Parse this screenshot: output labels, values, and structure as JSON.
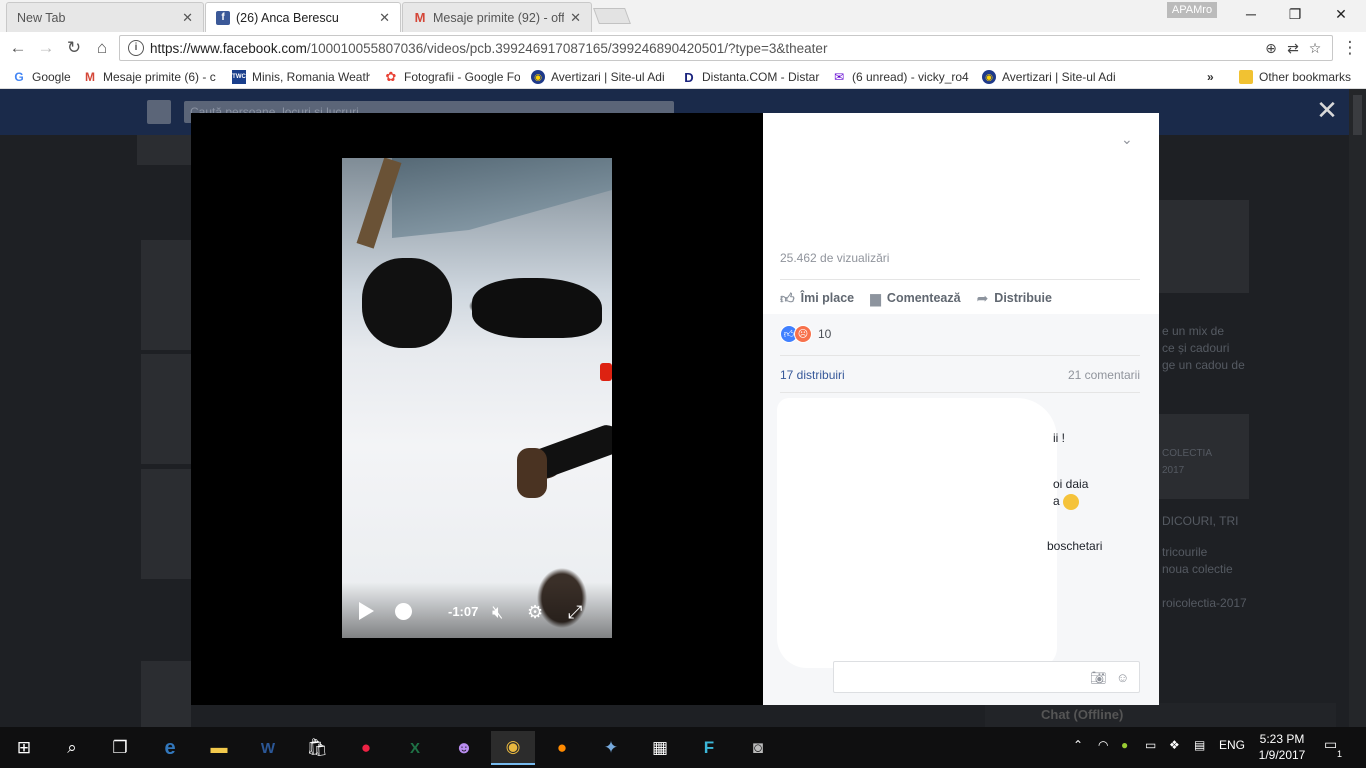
{
  "browser": {
    "tabs": [
      {
        "title": "New Tab",
        "active": false
      },
      {
        "title": "(26) Anca Berescu",
        "active": true
      },
      {
        "title": "Mesaje primite (92) - off",
        "active": false
      }
    ],
    "profile": "APAMro",
    "url_prefix": "https://www.facebook.com",
    "url_path": "/100010055807036/videos/pcb.399246917087165/399246890420501/?type=3&theater",
    "bookmarks": [
      {
        "label": "Google",
        "icon": "google-icon"
      },
      {
        "label": "Mesaje primite (6) - c",
        "icon": "gmail-icon"
      },
      {
        "label": "Minis, Romania Weath",
        "icon": "weather-channel-icon"
      },
      {
        "label": "Fotografii - Google Fo",
        "icon": "google-photos-icon"
      },
      {
        "label": "Avertizari | Site-ul Adi",
        "icon": "site-icon"
      },
      {
        "label": "Distanta.COM - Distar",
        "icon": "distanta-icon"
      },
      {
        "label": "(6 unread) - vicky_ro4",
        "icon": "yahoo-mail-icon"
      },
      {
        "label": "Avertizari | Site-ul Adi",
        "icon": "site-icon"
      }
    ],
    "bookmarks_overflow": "»",
    "other_bookmarks": "Other bookmarks"
  },
  "facebook_bg": {
    "search_placeholder": "Caută persoane, locuri și lucruri",
    "chat_label": "Chat (Offline)",
    "sidebar_snippets": [
      "e un mix de",
      "ce și cadouri",
      "ge un cadou de",
      "COLECTIA",
      "2017",
      "DICOURI, TRI",
      "tricourile",
      "noua colectie",
      "roicolectia-2017"
    ]
  },
  "video": {
    "time_remaining": "-1:07",
    "icons": [
      "play-icon",
      "mute-icon",
      "settings-icon",
      "fullscreen-icon"
    ]
  },
  "post": {
    "views": "25.462 de vizualizări",
    "actions": {
      "like": "Îmi place",
      "comment": "Comentează",
      "share": "Distribuie"
    },
    "reactions_count": "10",
    "shares": "17 distribuiri",
    "comments": "21 comentarii",
    "snippets": [
      "ii !",
      "oi daia",
      "a",
      "boschetari"
    ]
  },
  "taskbar": {
    "language": "ENG",
    "time": "5:23 PM",
    "date": "1/9/2017",
    "notifications": "1"
  },
  "colors": {
    "facebook_blue": "#365899",
    "link_blue": "#1a0dab",
    "taskbar_accent": "#76b9ed"
  }
}
